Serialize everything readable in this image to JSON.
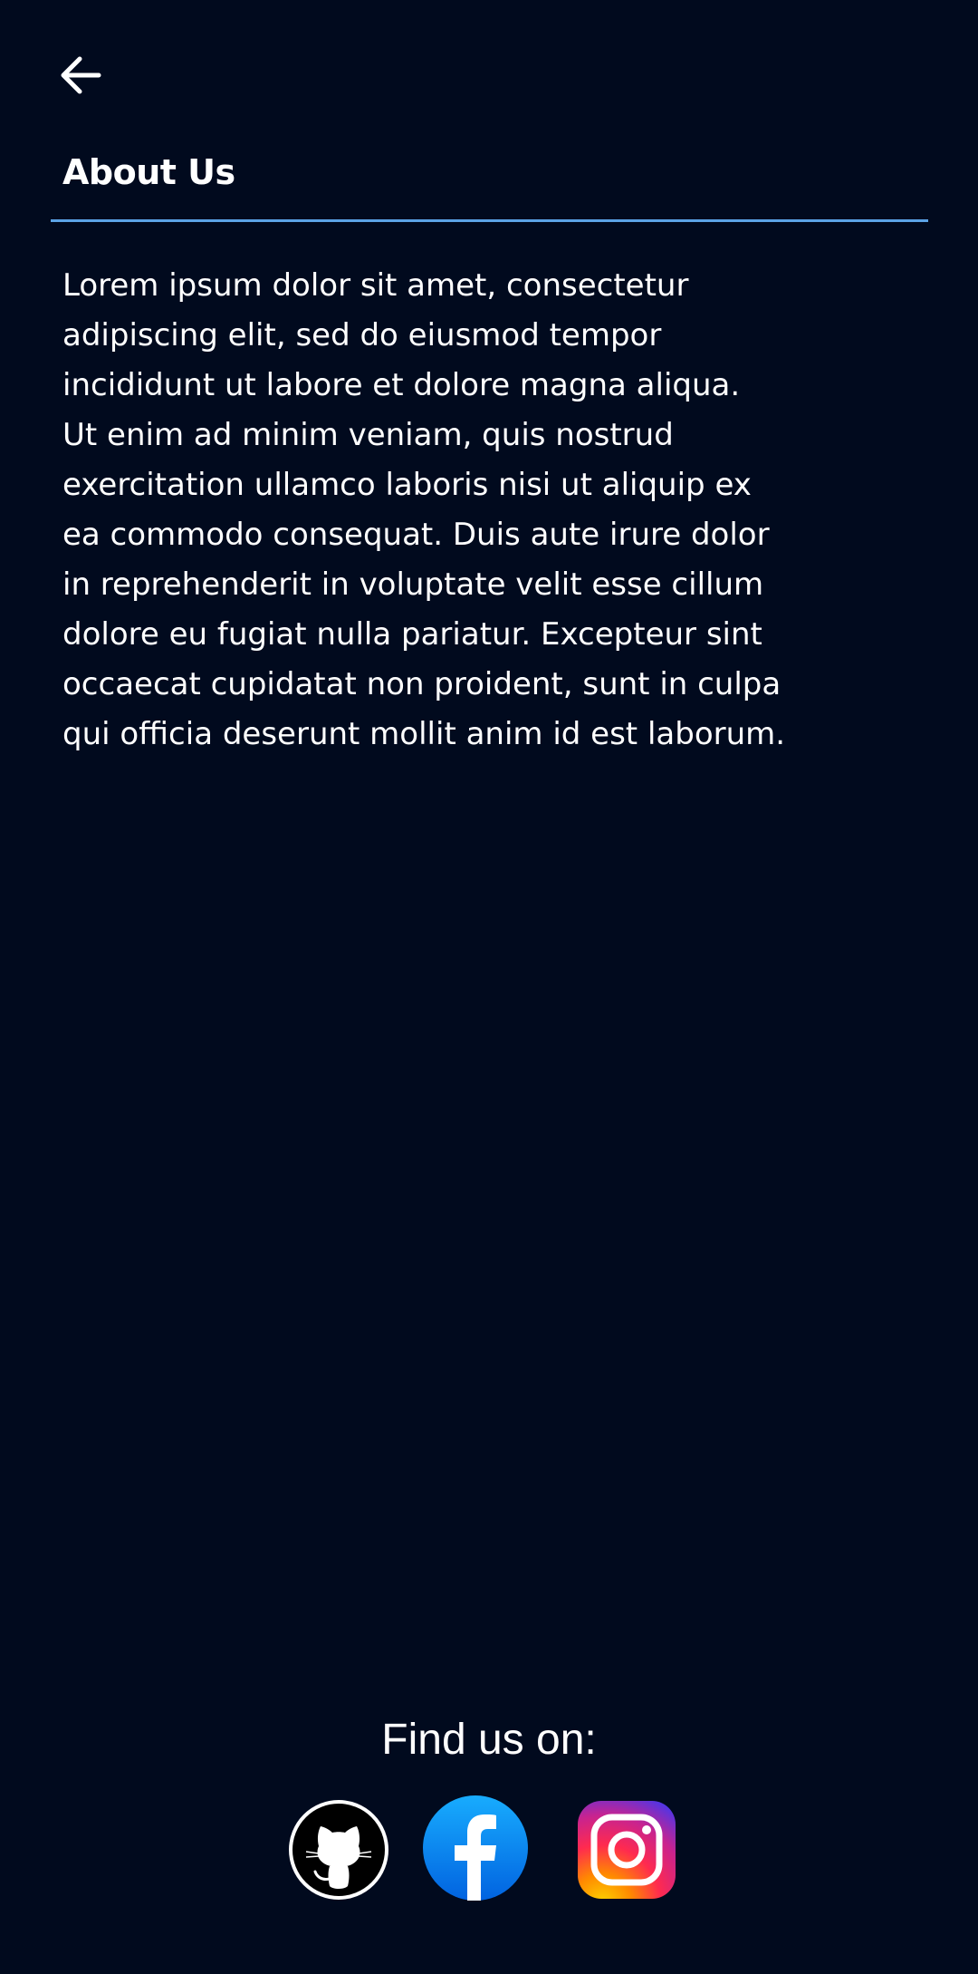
{
  "header": {
    "back_icon": "arrow-left-icon",
    "title": "About Us"
  },
  "content": {
    "body_lines": [
      "Lorem ipsum dolor sit amet, consectetur",
      "adipiscing elit, sed do eiusmod tempor",
      "incididunt ut labore et dolore magna aliqua.",
      "Ut enim ad minim veniam, quis nostrud",
      "exercitation ullamco laboris nisi ut aliquip ex",
      "ea commodo consequat. Duis aute irure dolor",
      "in reprehenderit in voluptate velit esse cillum",
      "dolore eu fugiat nulla pariatur. Excepteur sint",
      "occaecat cupidatat non proident, sunt in culpa",
      "qui officia deserunt mollit anim id est laborum."
    ]
  },
  "footer": {
    "find_us_label": "Find us on:",
    "socials": [
      {
        "icon": "github-icon"
      },
      {
        "icon": "facebook-icon",
        "color": "#1877f2"
      },
      {
        "icon": "instagram-icon"
      }
    ]
  },
  "colors": {
    "background": "#010a1e",
    "divider": "#5ba3e6",
    "text": "#ffffff"
  }
}
